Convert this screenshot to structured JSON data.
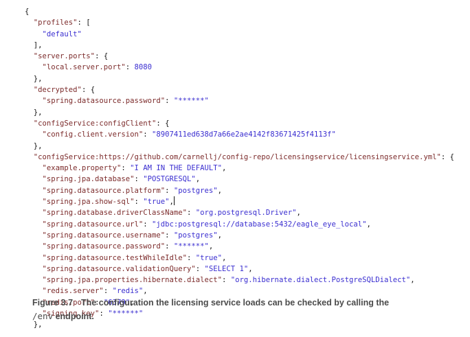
{
  "code_lines": [
    {
      "indent": 0,
      "pre": "{"
    },
    {
      "indent": 1,
      "key": "\"profiles\"",
      "mid": ": ["
    },
    {
      "indent": 2,
      "val": "\"default\""
    },
    {
      "indent": 1,
      "pre": "],"
    },
    {
      "indent": 1,
      "key": "\"server.ports\"",
      "mid": ": {"
    },
    {
      "indent": 2,
      "key": "\"local.server.port\"",
      "mid": ": ",
      "val": "8080"
    },
    {
      "indent": 1,
      "pre": "},"
    },
    {
      "indent": 1,
      "key": "\"decrypted\"",
      "mid": ": {"
    },
    {
      "indent": 2,
      "key": "\"spring.datasource.password\"",
      "mid": ": ",
      "val": "\"******\""
    },
    {
      "indent": 1,
      "pre": "},"
    },
    {
      "indent": 1,
      "key": "\"configService:configClient\"",
      "mid": ": {"
    },
    {
      "indent": 2,
      "key": "\"config.client.version\"",
      "mid": ": ",
      "val": "\"8907411ed638d7a66e2ae4142f83671425f4113f\""
    },
    {
      "indent": 1,
      "pre": "},"
    },
    {
      "indent": 1,
      "key": "\"configService:https://github.com/carnellj/config-repo/licensingservice/licensingservice.yml\"",
      "mid": ": {"
    },
    {
      "indent": 2,
      "key": "\"example.property\"",
      "mid": ": ",
      "val": "\"I AM IN THE DEFAULT\"",
      "tail": ","
    },
    {
      "indent": 2,
      "key": "\"spring.jpa.database\"",
      "mid": ": ",
      "val": "\"POSTGRESQL\"",
      "tail": ","
    },
    {
      "indent": 2,
      "key": "\"spring.datasource.platform\"",
      "mid": ": ",
      "val": "\"postgres\"",
      "tail": ","
    },
    {
      "indent": 2,
      "key": "\"spring.jpa.show-sql\"",
      "mid": ": ",
      "val": "\"true\"",
      "tail": ",",
      "cursor": true
    },
    {
      "indent": 2,
      "key": "\"spring.database.driverClassName\"",
      "mid": ": ",
      "val": "\"org.postgresql.Driver\"",
      "tail": ","
    },
    {
      "indent": 2,
      "key": "\"spring.datasource.url\"",
      "mid": ": ",
      "val": "\"jdbc:postgresql://database:5432/eagle_eye_local\"",
      "tail": ","
    },
    {
      "indent": 2,
      "key": "\"spring.datasource.username\"",
      "mid": ": ",
      "val": "\"postgres\"",
      "tail": ","
    },
    {
      "indent": 2,
      "key": "\"spring.datasource.password\"",
      "mid": ": ",
      "val": "\"******\"",
      "tail": ","
    },
    {
      "indent": 2,
      "key": "\"spring.datasource.testWhileIdle\"",
      "mid": ": ",
      "val": "\"true\"",
      "tail": ","
    },
    {
      "indent": 2,
      "key": "\"spring.datasource.validationQuery\"",
      "mid": ": ",
      "val": "\"SELECT 1\"",
      "tail": ","
    },
    {
      "indent": 2,
      "key": "\"spring.jpa.properties.hibernate.dialect\"",
      "mid": ": ",
      "val": "\"org.hibernate.dialect.PostgreSQLDialect\"",
      "tail": ","
    },
    {
      "indent": 2,
      "key": "\"redis.server\"",
      "mid": ": ",
      "val": "\"redis\"",
      "tail": ","
    },
    {
      "indent": 2,
      "key": "\"redis.port\"",
      "mid": ": ",
      "val": "\"6379\"",
      "tail": ","
    },
    {
      "indent": 2,
      "key": "\"signing.key\"",
      "mid": ": ",
      "val": "\"******\""
    },
    {
      "indent": 1,
      "pre": "},"
    }
  ],
  "caption": {
    "figure_label": "Figure 3.7",
    "text": "The configuration the licensing service loads can be checked by calling the",
    "code": "/env",
    "text_end": "endpoint."
  },
  "colors": {
    "key": "#7c2b2b",
    "value": "#3a2ed0",
    "caption": "#4a4a4a"
  }
}
